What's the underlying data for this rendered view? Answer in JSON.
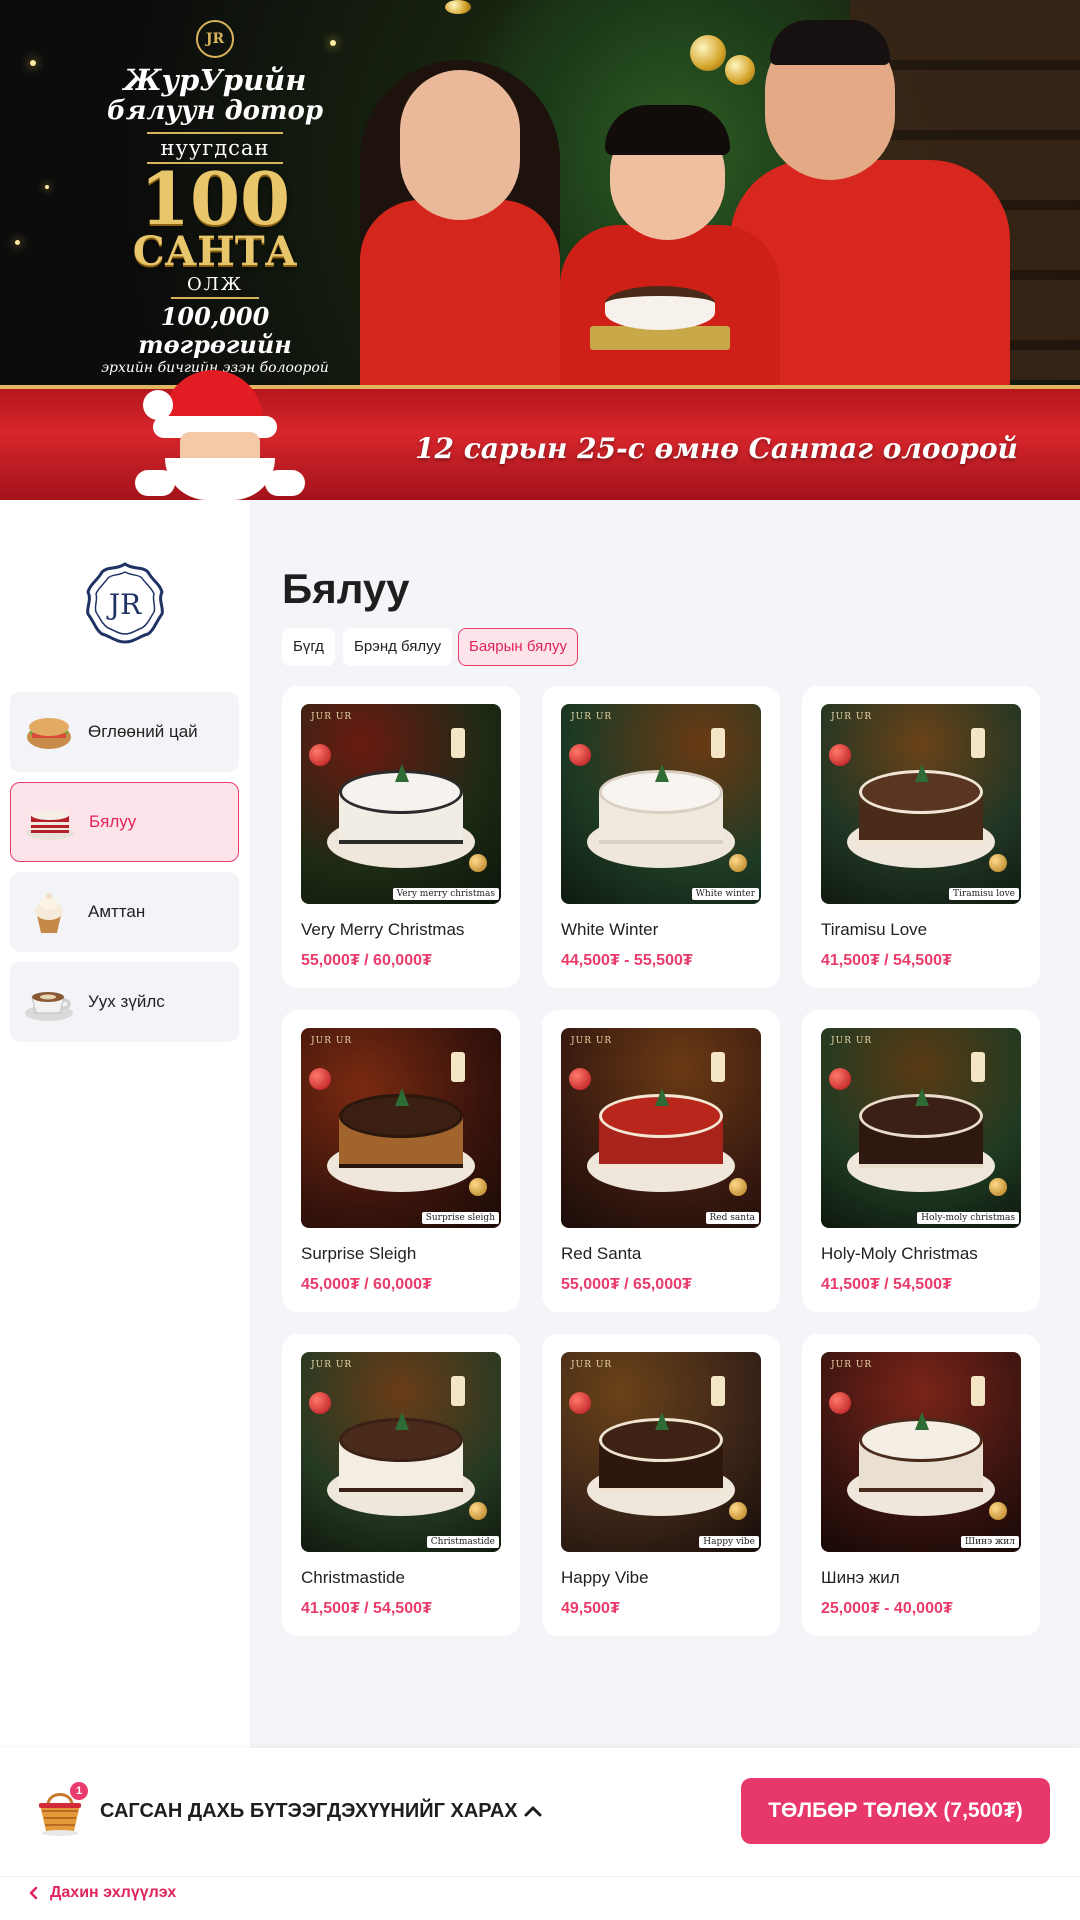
{
  "banner": {
    "brand_mark": "JR",
    "promo_line1": "ЖурУрийн",
    "promo_line2": "бялуун дотор",
    "promo_line3": "нуугдсан",
    "promo_big": "100",
    "promo_santa": "САНТА",
    "promo_olj": "ОЛЖ",
    "promo_prize": "100,000 төгрөгийн",
    "promo_prize_sub": "эрхийн бичгийн эзэн болоорой",
    "ribbon_text": "12 сарын 25-с өмнө Сантаг олоорой"
  },
  "sidebar": {
    "logo": "JR",
    "categories": [
      {
        "label": "Өглөөний цай",
        "icon": "sandwich-icon"
      },
      {
        "label": "Бялуу",
        "icon": "cake-icon",
        "active": true
      },
      {
        "label": "Амттан",
        "icon": "cupcake-icon"
      },
      {
        "label": "Уух зүйлс",
        "icon": "coffee-cup-icon"
      }
    ]
  },
  "main": {
    "title": "Бялуу",
    "filters": [
      {
        "label": "Бүгд"
      },
      {
        "label": "Брэнд бялуу"
      },
      {
        "label": "Баярын бялуу",
        "active": true
      }
    ],
    "products": [
      {
        "name": "Very Merry Christmas",
        "price": "55,000₮ / 60,000₮",
        "tag": "Very merry christmas"
      },
      {
        "name": "White Winter",
        "price": "44,500₮ - 55,500₮",
        "tag": "White winter"
      },
      {
        "name": "Tiramisu Love",
        "price": "41,500₮ / 54,500₮",
        "tag": "Tiramisu love"
      },
      {
        "name": "Surprise Sleigh",
        "price": "45,000₮ / 60,000₮",
        "tag": "Surprise sleigh"
      },
      {
        "name": "Red Santa",
        "price": "55,000₮ / 65,000₮",
        "tag": "Red santa"
      },
      {
        "name": "Holy-Moly Christmas",
        "price": "41,500₮ / 54,500₮",
        "tag": "Holy-moly christmas"
      },
      {
        "name": "Christmastide",
        "price": "41,500₮ / 54,500₮",
        "tag": "Christmastide"
      },
      {
        "name": "Happy Vibe",
        "price": "49,500₮",
        "tag": "Happy vibe"
      },
      {
        "name": "Шинэ жил",
        "price": "25,000₮ - 40,000₮",
        "tag": "Шинэ жил"
      }
    ],
    "image_brand": "JUR UR"
  },
  "cart": {
    "count": "1",
    "label": "САГСАН ДАХЬ БҮТЭЭГДЭХҮҮНИЙГ ХАРАХ",
    "pay_label": "ТӨЛБӨР ТӨЛӨХ (7,500₮)",
    "back_label": "Дахин эхлүүлэх"
  },
  "colors": {
    "accent": "#e8376a",
    "active_bg": "#fde4ea",
    "panel_bg": "#f4f5f8"
  }
}
